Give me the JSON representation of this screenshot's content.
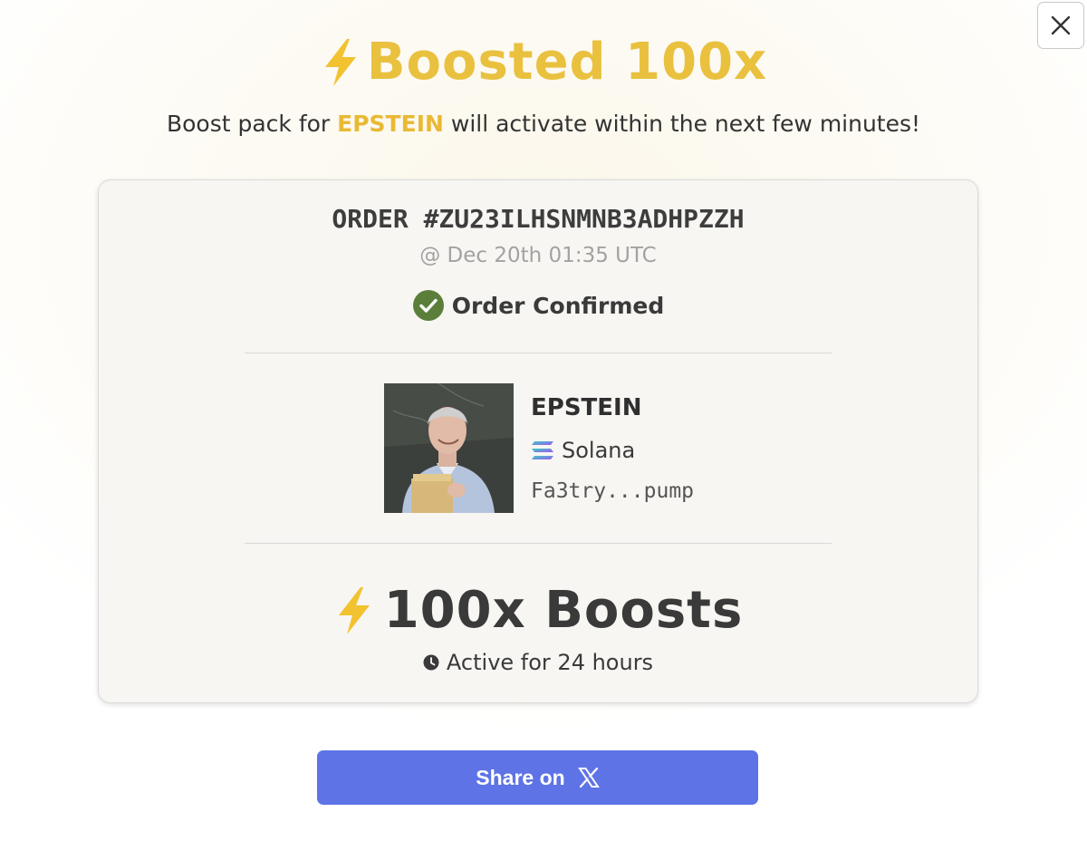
{
  "dialog": {
    "close_icon": "close-icon"
  },
  "headline": {
    "icon": "lightning-icon",
    "text": "Boosted 100x",
    "color": "#e9c13f"
  },
  "subtitle": {
    "prefix": "Boost pack for ",
    "token": "EPSTEIN",
    "suffix": " will activate within the next few minutes!"
  },
  "order": {
    "title": "ORDER #ZU23ILHSNMNB3ADHPZZH",
    "timestamp": "@ Dec 20th 01:35 UTC",
    "status": "Order Confirmed",
    "status_icon": "check-circle-icon",
    "status_color": "#5b7f3b"
  },
  "token": {
    "name": "EPSTEIN",
    "chain": "Solana",
    "chain_icon": "solana-icon",
    "address": "Fa3try...pump",
    "image": "token-avatar"
  },
  "boosts": {
    "icon": "lightning-icon",
    "label": "100x Boosts",
    "duration": "Active for 24 hours",
    "duration_icon": "clock-icon"
  },
  "share": {
    "label": "Share on",
    "icon": "x-logo-icon",
    "color": "#5e73e6"
  }
}
